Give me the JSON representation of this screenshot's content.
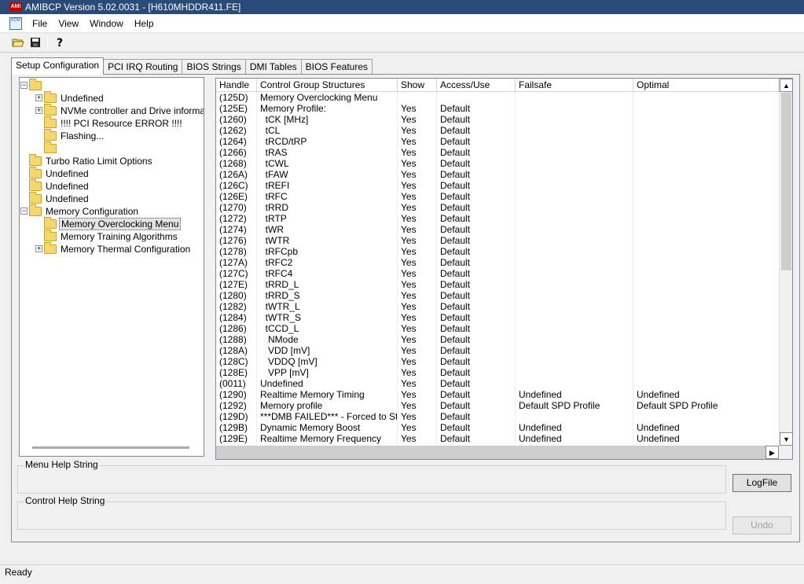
{
  "window": {
    "title": "AMIBCP Version 5.02.0031 - [H610MHDDR411.FE]",
    "logo_text": "AMI",
    "doc_icon_text": "ROM"
  },
  "menu": [
    "File",
    "View",
    "Window",
    "Help"
  ],
  "toolbar": {
    "open_icon": "open-folder-icon",
    "save_icon": "save-disk-icon",
    "help_icon": "help-question-icon"
  },
  "tabs": [
    "Setup Configuration",
    "PCI IRQ Routing",
    "BIOS Strings",
    "DMI Tables",
    "BIOS Features"
  ],
  "tree": [
    {
      "label": "",
      "level": 0,
      "expander": "-"
    },
    {
      "label": "Undefined",
      "level": 1,
      "expander": "+"
    },
    {
      "label": "NVMe controller and Drive information",
      "level": 1,
      "expander": "+"
    },
    {
      "label": "!!!! PCI Resource ERROR !!!!",
      "level": 1,
      "expander": ""
    },
    {
      "label": "Flashing...",
      "level": 1,
      "expander": ""
    },
    {
      "label": "",
      "level": 1,
      "expander": ""
    },
    {
      "label": "Turbo Ratio Limit Options",
      "level": 0,
      "expander": ""
    },
    {
      "label": "Undefined",
      "level": 0,
      "expander": ""
    },
    {
      "label": "Undefined",
      "level": 0,
      "expander": ""
    },
    {
      "label": "Undefined",
      "level": 0,
      "expander": ""
    },
    {
      "label": "Memory Configuration",
      "level": 0,
      "expander": "-"
    },
    {
      "label": "Memory Overclocking Menu",
      "level": 1,
      "expander": "",
      "selected": true
    },
    {
      "label": "Memory Training Algorithms",
      "level": 1,
      "expander": ""
    },
    {
      "label": "Memory Thermal Configuration",
      "level": 1,
      "expander": "+"
    }
  ],
  "grid": {
    "columns": [
      "Handle",
      "Control Group Structures",
      "Show",
      "Access/Use",
      "Failsafe",
      "Optimal"
    ],
    "rows": [
      [
        "(125D)",
        "Memory Overclocking Menu",
        "",
        "",
        "",
        ""
      ],
      [
        "(125E)",
        "Memory Profile:",
        "Yes",
        "Default",
        "",
        ""
      ],
      [
        "(1260)",
        "  tCK [MHz]",
        "Yes",
        "Default",
        "",
        ""
      ],
      [
        "(1262)",
        "  tCL",
        "Yes",
        "Default",
        "",
        ""
      ],
      [
        "(1264)",
        "  tRCD/tRP",
        "Yes",
        "Default",
        "",
        ""
      ],
      [
        "(1266)",
        "  tRAS",
        "Yes",
        "Default",
        "",
        ""
      ],
      [
        "(1268)",
        "  tCWL",
        "Yes",
        "Default",
        "",
        ""
      ],
      [
        "(126A)",
        "  tFAW",
        "Yes",
        "Default",
        "",
        ""
      ],
      [
        "(126C)",
        "  tREFI",
        "Yes",
        "Default",
        "",
        ""
      ],
      [
        "(126E)",
        "  tRFC",
        "Yes",
        "Default",
        "",
        ""
      ],
      [
        "(1270)",
        "  tRRD",
        "Yes",
        "Default",
        "",
        ""
      ],
      [
        "(1272)",
        "  tRTP",
        "Yes",
        "Default",
        "",
        ""
      ],
      [
        "(1274)",
        "  tWR",
        "Yes",
        "Default",
        "",
        ""
      ],
      [
        "(1276)",
        "  tWTR",
        "Yes",
        "Default",
        "",
        ""
      ],
      [
        "(1278)",
        "  tRFCpb",
        "Yes",
        "Default",
        "",
        ""
      ],
      [
        "(127A)",
        "  tRFC2",
        "Yes",
        "Default",
        "",
        ""
      ],
      [
        "(127C)",
        "  tRFC4",
        "Yes",
        "Default",
        "",
        ""
      ],
      [
        "(127E)",
        "  tRRD_L",
        "Yes",
        "Default",
        "",
        ""
      ],
      [
        "(1280)",
        "  tRRD_S",
        "Yes",
        "Default",
        "",
        ""
      ],
      [
        "(1282)",
        "  tWTR_L",
        "Yes",
        "Default",
        "",
        ""
      ],
      [
        "(1284)",
        "  tWTR_S",
        "Yes",
        "Default",
        "",
        ""
      ],
      [
        "(1286)",
        "  tCCD_L",
        "Yes",
        "Default",
        "",
        ""
      ],
      [
        "(1288)",
        "   NMode",
        "Yes",
        "Default",
        "",
        ""
      ],
      [
        "(128A)",
        "   VDD [mV]",
        "Yes",
        "Default",
        "",
        ""
      ],
      [
        "(128C)",
        "   VDDQ [mV]",
        "Yes",
        "Default",
        "",
        ""
      ],
      [
        "(128E)",
        "   VPP [mV]",
        "Yes",
        "Default",
        "",
        ""
      ],
      [
        "(0011)",
        "Undefined",
        "Yes",
        "Default",
        "",
        ""
      ],
      [
        "(1290)",
        "Realtime Memory Timing",
        "Yes",
        "Default",
        "Undefined",
        "Undefined"
      ],
      [
        "(1292)",
        "Memory profile",
        "Yes",
        "Default",
        "Default SPD Profile",
        "Default SPD Profile"
      ],
      [
        "(129D)",
        "***DMB FAILED*** - Forced to St...",
        "Yes",
        "Default",
        "",
        ""
      ],
      [
        "(129B)",
        "Dynamic Memory Boost",
        "Yes",
        "Default",
        "Undefined",
        "Undefined"
      ],
      [
        "(129E)",
        "Realtime Memory Frequency",
        "Yes",
        "Default",
        "Undefined",
        "Undefined"
      ]
    ]
  },
  "help": {
    "menu_label": "Menu Help String",
    "control_label": "Control Help String"
  },
  "buttons": {
    "logfile": "LogFile",
    "undo": "Undo"
  },
  "status": "Ready"
}
